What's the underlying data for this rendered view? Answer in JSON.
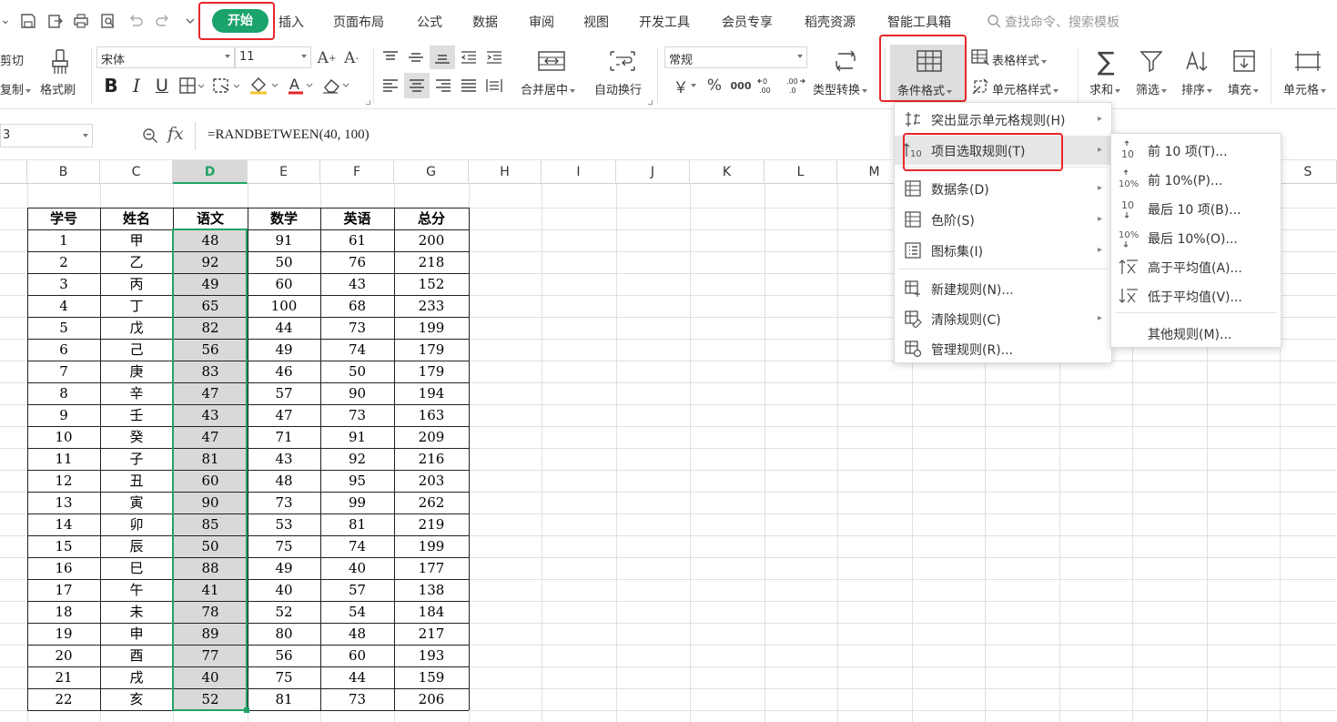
{
  "quick_access": {
    "icons": [
      "save-icon",
      "export-icon",
      "print-icon",
      "print-preview-icon",
      "undo-icon",
      "redo-icon",
      "customize-icon"
    ]
  },
  "tabs": [
    "开始",
    "插入",
    "页面布局",
    "公式",
    "数据",
    "审阅",
    "视图",
    "开发工具",
    "会员专享",
    "稻壳资源",
    "智能工具箱"
  ],
  "search_label": "查找命令、搜索模板",
  "ribbon": {
    "cut": "剪切",
    "copy": "复制",
    "format_painter": "格式刷",
    "font_name": "宋体",
    "font_size": "11",
    "merge_center": "合并居中",
    "wrap_text": "自动换行",
    "number_format": "常规",
    "type_convert": "类型转换",
    "cond_format": "条件格式",
    "table_style": "表格样式",
    "cell_style": "单元格样式",
    "sum": "求和",
    "filter": "筛选",
    "sort": "排序",
    "fill": "填充",
    "cell": "单元格"
  },
  "formula_bar": {
    "name_box": "3",
    "fx": "fx",
    "formula": "=RANDBETWEEN(40, 100)"
  },
  "columns": [
    "B",
    "C",
    "D",
    "E",
    "F",
    "G",
    "H",
    "I",
    "J",
    "K",
    "L",
    "M",
    "S"
  ],
  "table": {
    "headers": [
      "学号",
      "姓名",
      "语文",
      "数学",
      "英语",
      "总分"
    ],
    "rows": [
      [
        "1",
        "甲",
        "48",
        "91",
        "61",
        "200"
      ],
      [
        "2",
        "乙",
        "92",
        "50",
        "76",
        "218"
      ],
      [
        "3",
        "丙",
        "49",
        "60",
        "43",
        "152"
      ],
      [
        "4",
        "丁",
        "65",
        "100",
        "68",
        "233"
      ],
      [
        "5",
        "戊",
        "82",
        "44",
        "73",
        "199"
      ],
      [
        "6",
        "己",
        "56",
        "49",
        "74",
        "179"
      ],
      [
        "7",
        "庚",
        "83",
        "46",
        "50",
        "179"
      ],
      [
        "8",
        "辛",
        "47",
        "57",
        "90",
        "194"
      ],
      [
        "9",
        "壬",
        "43",
        "47",
        "73",
        "163"
      ],
      [
        "10",
        "癸",
        "47",
        "71",
        "91",
        "209"
      ],
      [
        "11",
        "子",
        "81",
        "43",
        "92",
        "216"
      ],
      [
        "12",
        "丑",
        "60",
        "48",
        "95",
        "203"
      ],
      [
        "13",
        "寅",
        "90",
        "73",
        "99",
        "262"
      ],
      [
        "14",
        "卯",
        "85",
        "53",
        "81",
        "219"
      ],
      [
        "15",
        "辰",
        "50",
        "75",
        "74",
        "199"
      ],
      [
        "16",
        "巳",
        "88",
        "49",
        "40",
        "177"
      ],
      [
        "17",
        "午",
        "41",
        "40",
        "57",
        "138"
      ],
      [
        "18",
        "未",
        "78",
        "52",
        "54",
        "184"
      ],
      [
        "19",
        "申",
        "89",
        "80",
        "48",
        "217"
      ],
      [
        "20",
        "酉",
        "77",
        "56",
        "60",
        "193"
      ],
      [
        "21",
        "戌",
        "40",
        "75",
        "44",
        "159"
      ],
      [
        "22",
        "亥",
        "52",
        "81",
        "73",
        "206"
      ]
    ]
  },
  "cond_menu": {
    "items": [
      {
        "label": "突出显示单元格规则(H)",
        "icon": "highlight-rules-icon",
        "sub": true
      },
      {
        "label": "项目选取规则(T)",
        "icon": "top-bottom-rules-icon",
        "sub": true
      },
      {
        "label": "数据条(D)",
        "icon": "data-bars-icon",
        "sub": true
      },
      {
        "label": "色阶(S)",
        "icon": "color-scale-icon",
        "sub": true
      },
      {
        "label": "图标集(I)",
        "icon": "icon-sets-icon",
        "sub": true
      },
      {
        "label": "新建规则(N)...",
        "icon": "new-rule-icon",
        "sub": false
      },
      {
        "label": "清除规则(C)",
        "icon": "clear-rules-icon",
        "sub": true
      },
      {
        "label": "管理规则(R)...",
        "icon": "manage-rules-icon",
        "sub": false
      }
    ]
  },
  "sub_menu": {
    "items": [
      {
        "label": "前 10 项(T)...",
        "icon": "top-10-icon"
      },
      {
        "label": "前 10%(P)...",
        "icon": "top-10-percent-icon"
      },
      {
        "label": "最后 10 项(B)...",
        "icon": "bottom-10-icon"
      },
      {
        "label": "最后 10%(O)...",
        "icon": "bottom-10-percent-icon"
      },
      {
        "label": "高于平均值(A)...",
        "icon": "above-average-icon"
      },
      {
        "label": "低于平均值(V)...",
        "icon": "below-average-icon"
      },
      {
        "label": "其他规则(M)...",
        "icon": ""
      }
    ]
  },
  "colors": {
    "accent": "#1aa36b",
    "highlight": "#e8262a",
    "selection_fill": "#d9d9d9",
    "selection_border": "#21a366"
  }
}
